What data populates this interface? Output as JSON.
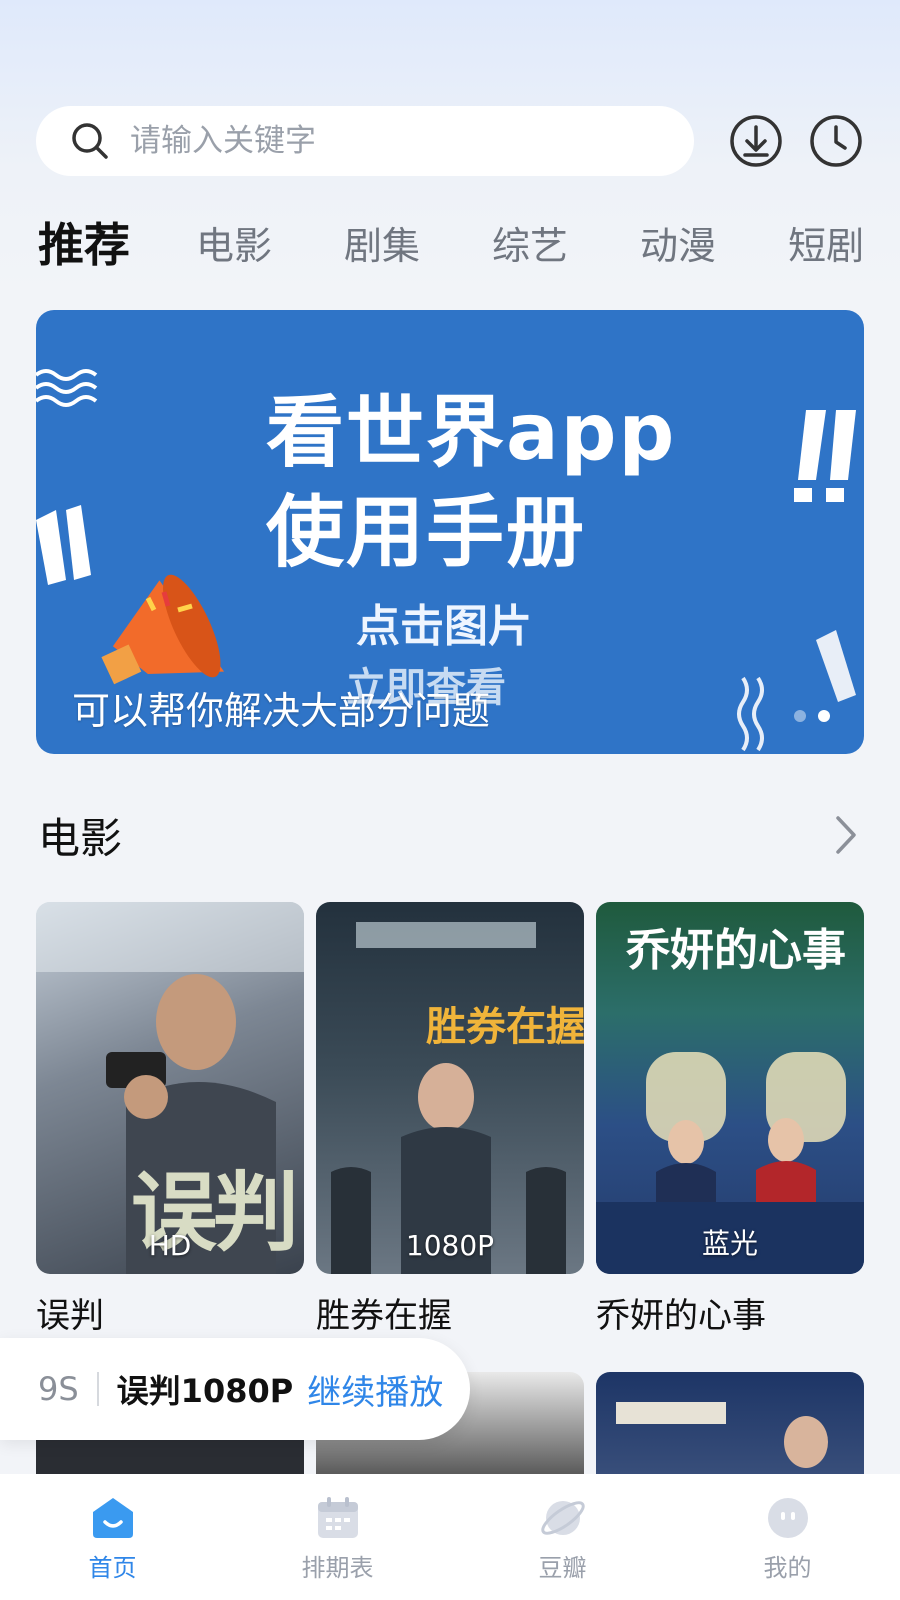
{
  "search": {
    "placeholder": "请输入关键字"
  },
  "header_icons": [
    "download-icon",
    "history-icon"
  ],
  "tabs": [
    {
      "label": "推荐",
      "active": true
    },
    {
      "label": "电影"
    },
    {
      "label": "剧集"
    },
    {
      "label": "综艺"
    },
    {
      "label": "动漫"
    },
    {
      "label": "短剧"
    }
  ],
  "banner": {
    "title_line1": "看世界app",
    "title_line2": "使用手册",
    "sub_line1": "点击图片",
    "sub_line2": "立即查看",
    "caption": "可以帮你解决大部分问题",
    "dots": 2,
    "active_dot": 1
  },
  "movies_section": {
    "title": "电影",
    "items": [
      {
        "title": "误判",
        "quality": "HD",
        "poster_text": "误判"
      },
      {
        "title": "胜券在握",
        "quality": "1080P",
        "poster_text": "胜券在握"
      },
      {
        "title": "乔妍的心事",
        "quality": "蓝光",
        "poster_text": "乔妍的心事"
      }
    ]
  },
  "continue_bar": {
    "time": "9S",
    "name": "误判1080P",
    "action": "继续播放"
  },
  "bottom_nav": [
    {
      "label": "首页",
      "icon": "home-icon",
      "active": true
    },
    {
      "label": "排期表",
      "icon": "calendar-icon"
    },
    {
      "label": "豆瓣",
      "icon": "planet-icon"
    },
    {
      "label": "我的",
      "icon": "profile-icon"
    }
  ],
  "colors": {
    "accent": "#2f86e8",
    "banner": "#2f74c7"
  }
}
